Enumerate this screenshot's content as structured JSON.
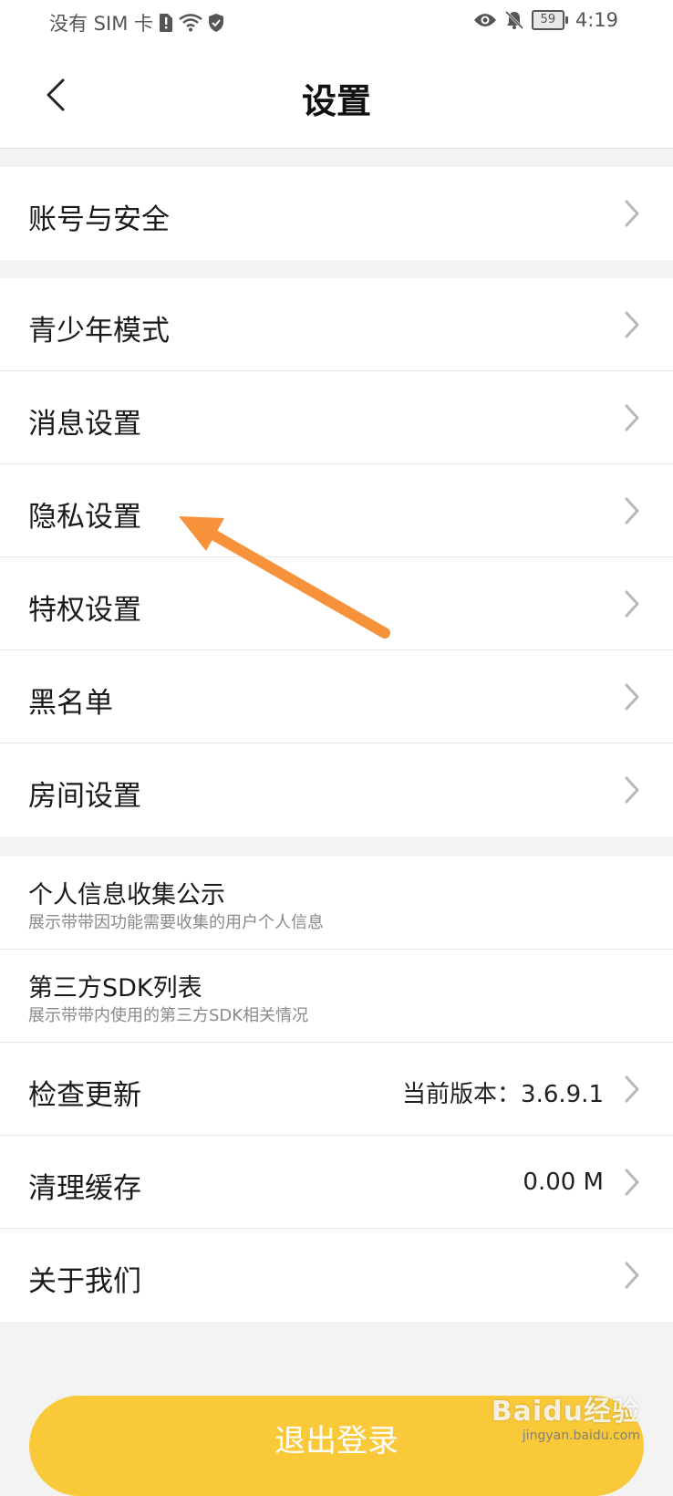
{
  "status_bar": {
    "carrier": "没有 SIM 卡",
    "battery_level": "59",
    "time": "4:19"
  },
  "header": {
    "title": "设置"
  },
  "groups": {
    "account": [
      {
        "label": "账号与安全"
      }
    ],
    "settings": [
      {
        "label": "青少年模式"
      },
      {
        "label": "消息设置"
      },
      {
        "label": "隐私设置"
      },
      {
        "label": "特权设置"
      },
      {
        "label": "黑名单"
      },
      {
        "label": "房间设置"
      }
    ],
    "info": [
      {
        "label": "个人信息收集公示",
        "sub": "展示带带因功能需要收集的用户个人信息"
      },
      {
        "label": "第三方SDK列表",
        "sub": "展示带带内使用的第三方SDK相关情况"
      },
      {
        "label": "检查更新",
        "value": "当前版本：3.6.9.1"
      },
      {
        "label": "清理缓存",
        "value": "0.00 M"
      },
      {
        "label": "关于我们"
      }
    ]
  },
  "logout": {
    "label": "退出登录"
  },
  "watermark": {
    "brand": "Baidu经验",
    "domain": "jingyan.baidu.com"
  },
  "colors": {
    "accent_yellow": "#f9c93a",
    "annotation_arrow": "#f7923a",
    "chevron": "#b8b8b8",
    "divider": "#e8e8e8",
    "background": "#f3f3f3"
  },
  "icons": {
    "back": "chevron-left-icon",
    "row_chevron": "chevron-right-icon",
    "status": [
      "sim-alert-icon",
      "wifi-icon",
      "shield-icon",
      "eye-icon",
      "bell-off-icon",
      "battery-icon"
    ]
  }
}
